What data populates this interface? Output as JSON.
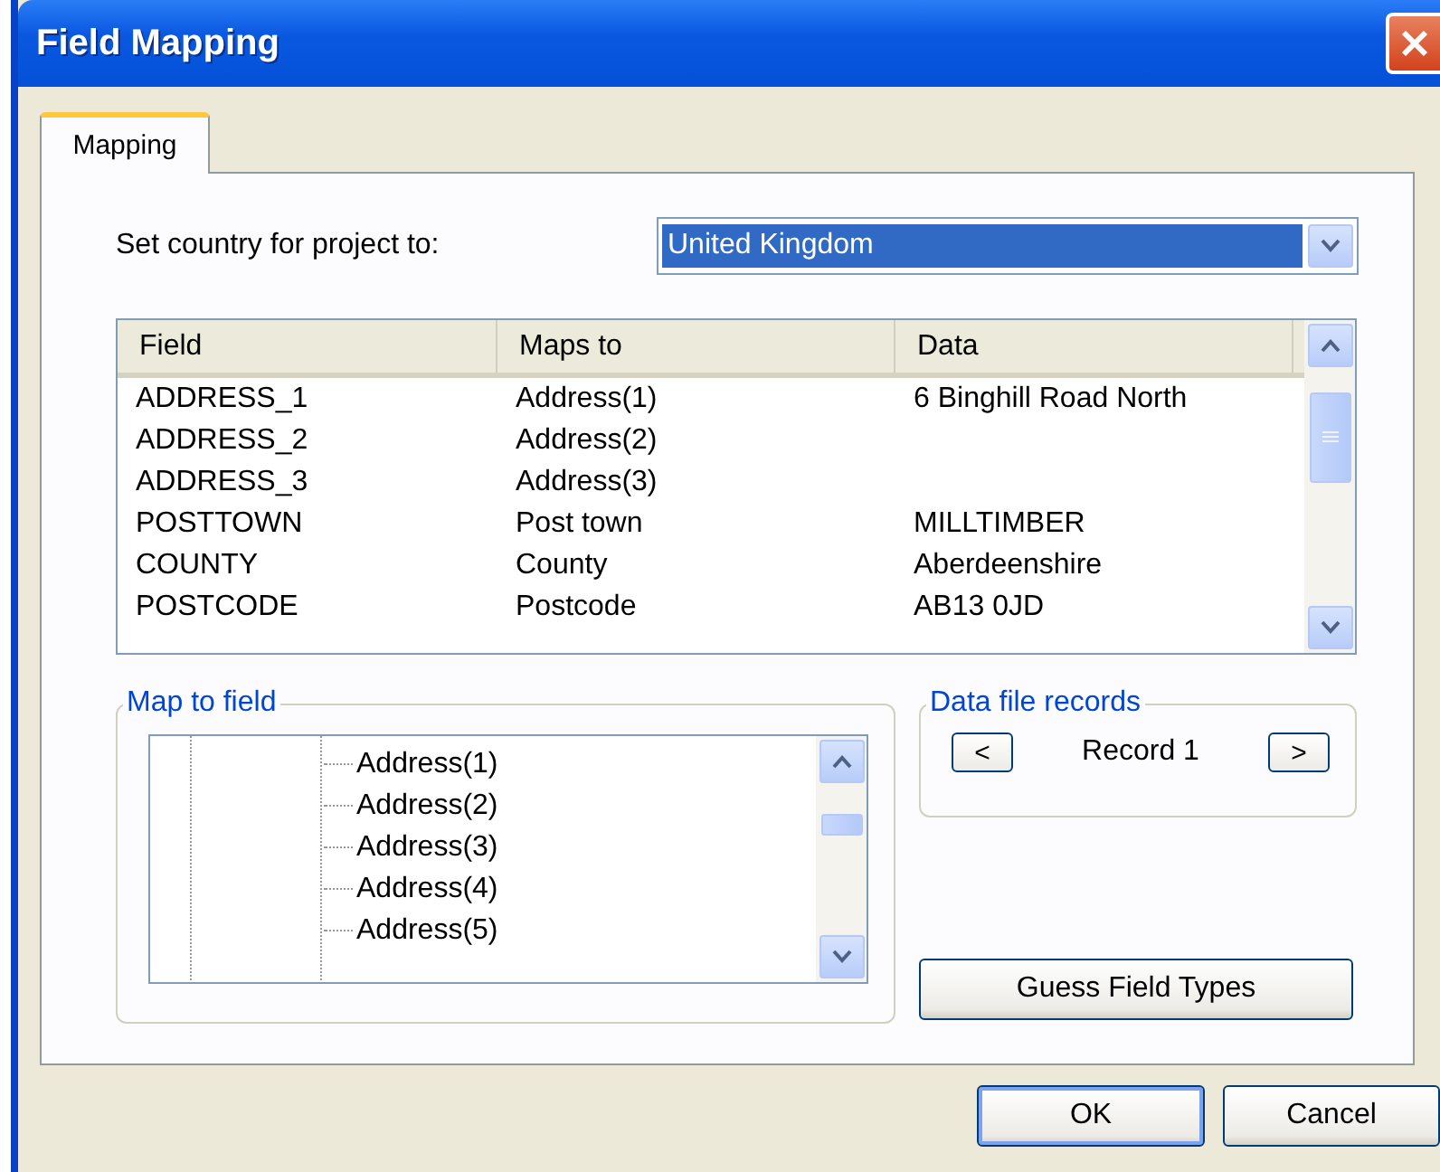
{
  "window": {
    "title": "Field Mapping"
  },
  "tabs": [
    {
      "label": "Mapping",
      "selected": true
    }
  ],
  "country": {
    "label": "Set country for project to:",
    "value": "United Kingdom"
  },
  "table": {
    "columns": [
      "Field",
      "Maps to",
      "Data"
    ],
    "rows": [
      [
        "ADDRESS_1",
        "Address(1)",
        "6 Binghill Road North"
      ],
      [
        "ADDRESS_2",
        "Address(2)",
        ""
      ],
      [
        "ADDRESS_3",
        "Address(3)",
        ""
      ],
      [
        "POSTTOWN",
        "Post town",
        "MILLTIMBER"
      ],
      [
        "COUNTY",
        "County",
        "Aberdeenshire"
      ],
      [
        "POSTCODE",
        "Postcode",
        "AB13 0JD"
      ]
    ]
  },
  "map_to_field": {
    "title": "Map to field",
    "items": [
      "Address(1)",
      "Address(2)",
      "Address(3)",
      "Address(4)",
      "Address(5)"
    ]
  },
  "records": {
    "title": "Data file records",
    "previous": "<",
    "record": "Record 1",
    "next": ">"
  },
  "guess_button": "Guess Field Types",
  "buttons": [
    {
      "label": "OK",
      "default": true
    },
    {
      "label": "Cancel",
      "default": false
    }
  ]
}
